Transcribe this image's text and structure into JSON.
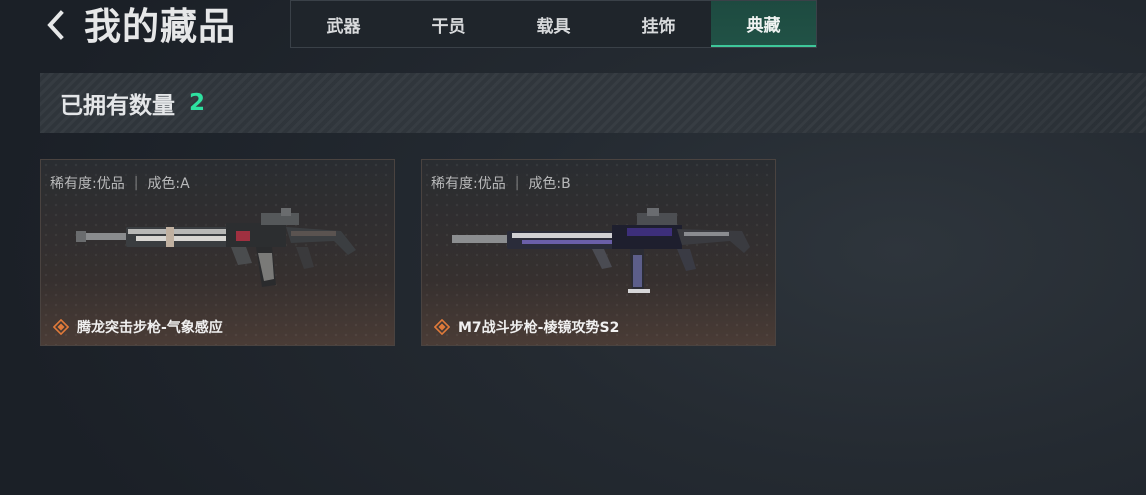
{
  "header": {
    "title": "我的藏品",
    "back_icon": "chevron-left-icon"
  },
  "tabs": [
    {
      "label": "武器",
      "active": false
    },
    {
      "label": "干员",
      "active": false
    },
    {
      "label": "载具",
      "active": false
    },
    {
      "label": "挂饰",
      "active": false
    },
    {
      "label": "典藏",
      "active": true
    }
  ],
  "summary": {
    "label": "已拥有数量",
    "count": "2"
  },
  "items": [
    {
      "rarity": "稀有度:优品",
      "condition": "成色:A",
      "name": "腾龙突击步枪-气象感应",
      "rarity_icon": "diamond-rarity-icon",
      "image": "rifle-image"
    },
    {
      "rarity": "稀有度:优品",
      "condition": "成色:B",
      "name": "M7战斗步枪-棱镜攻势S2",
      "rarity_icon": "diamond-rarity-icon",
      "image": "rifle-image"
    }
  ],
  "colors": {
    "accent": "#2ee0a0",
    "tab_active": "#215246",
    "rarity_icon": "#e07a3a"
  }
}
